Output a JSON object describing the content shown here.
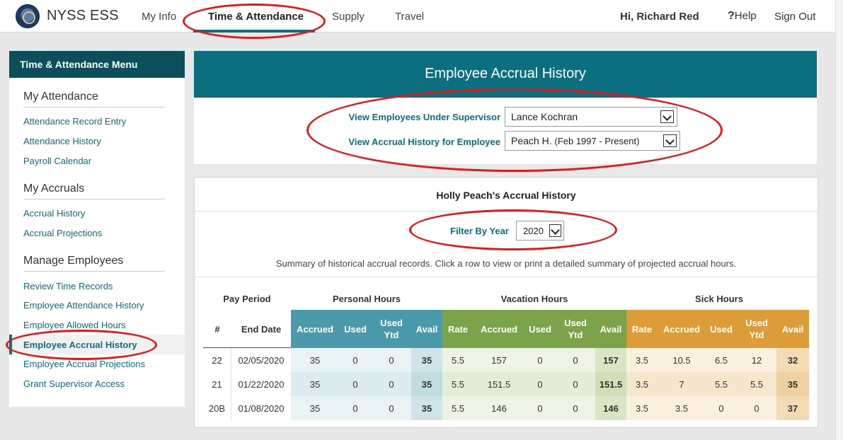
{
  "nav": {
    "brand": "NYSS ESS",
    "items": [
      "My Info",
      "Time & Attendance",
      "Supply",
      "Travel"
    ],
    "greeting": "Hi, Richard Red",
    "help_label": "Help",
    "signout_label": "Sign Out"
  },
  "sidebar": {
    "header": "Time & Attendance Menu",
    "sections": [
      {
        "title": "My Attendance",
        "links": [
          "Attendance Record Entry",
          "Attendance History",
          "Payroll Calendar"
        ]
      },
      {
        "title": "My Accruals",
        "links": [
          "Accrual History",
          "Accrual Projections"
        ]
      },
      {
        "title": "Manage Employees",
        "links": [
          "Review Time Records",
          "Employee Attendance History",
          "Employee Allowed Hours",
          "Employee Accrual History",
          "Employee Accrual Projections",
          "Grant Supervisor Access"
        ]
      }
    ],
    "active_link": "Employee Accrual History"
  },
  "page": {
    "title": "Employee Accrual History",
    "supervisor_label": "View Employees Under Supervisor",
    "supervisor_value": "Lance Kochran",
    "employee_label": "View Accrual History for Employee",
    "employee_value": "Peach H.",
    "employee_range": "(Feb 1997 - Present)"
  },
  "accrual": {
    "title": "Holly Peach's Accrual History",
    "filter_label": "Filter By Year",
    "year": "2020",
    "summary": "Summary of historical accrual records. Click a row to view or print a detailed summary of projected accrual hours.",
    "groups": {
      "pay_period": "Pay Period",
      "personal": "Personal Hours",
      "vacation": "Vacation Hours",
      "sick": "Sick Hours"
    },
    "columns": [
      "#",
      "End Date",
      "Accrued",
      "Used",
      "Used Ytd",
      "Avail",
      "Rate",
      "Accrued",
      "Used",
      "Used Ytd",
      "Avail",
      "Rate",
      "Accrued",
      "Used",
      "Used Ytd",
      "Avail"
    ],
    "rows": [
      [
        "22",
        "02/05/2020",
        "35",
        "0",
        "0",
        "35",
        "5.5",
        "157",
        "0",
        "0",
        "157",
        "3.5",
        "10.5",
        "6.5",
        "12",
        "32"
      ],
      [
        "21",
        "01/22/2020",
        "35",
        "0",
        "0",
        "35",
        "5.5",
        "151.5",
        "0",
        "0",
        "151.5",
        "3.5",
        "7",
        "5.5",
        "5.5",
        "35"
      ],
      [
        "20B",
        "01/08/2020",
        "35",
        "0",
        "0",
        "35",
        "5.5",
        "146",
        "0",
        "0",
        "146",
        "3.5",
        "3.5",
        "0",
        "0",
        "37"
      ]
    ]
  },
  "colors": {
    "teal": "#0b6f7f",
    "personal": "#4b9aab",
    "vacation": "#7da34a",
    "sick": "#dc9c37",
    "annotation": "#e01a1a"
  }
}
